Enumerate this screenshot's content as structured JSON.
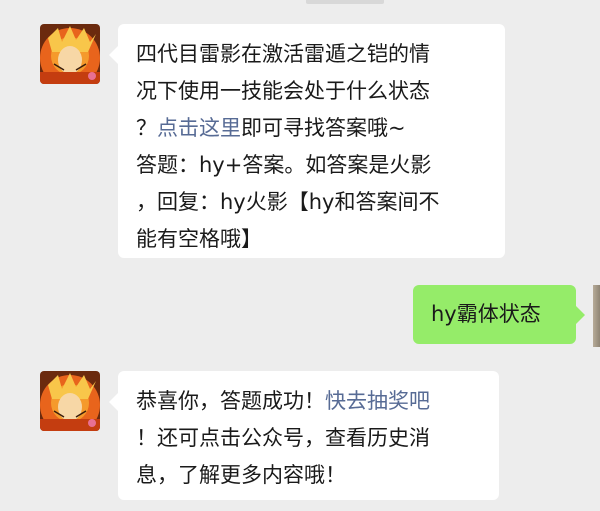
{
  "messages": [
    {
      "sender": "official-account",
      "lines": [
        [
          "四代目雷影在激活雷遁之铠的情"
        ],
        [
          "况下使用一技能会处于什么状态"
        ],
        [
          "？",
          "点击这里",
          "即可寻找答案哦~"
        ],
        [
          "答题：hy+答案。如答案是火影"
        ],
        [
          "，回复：hy火影【hy和答案间不"
        ],
        [
          "能有空格哦】"
        ]
      ]
    },
    {
      "sender": "user",
      "text": "hy霸体状态"
    },
    {
      "sender": "official-account",
      "lines": [
        [
          "恭喜你，答题成功！",
          "快去抽奖吧"
        ],
        [
          "！还可点击公众号，查看历史消"
        ],
        [
          "息，了解更多内容哦！"
        ]
      ]
    }
  ],
  "colors": {
    "background": "#ededed",
    "incoming_bubble": "#ffffff",
    "outgoing_bubble": "#95ec69",
    "link": "#576b95"
  },
  "icons": {
    "sender_avatar": "naruto-avatar-icon"
  }
}
